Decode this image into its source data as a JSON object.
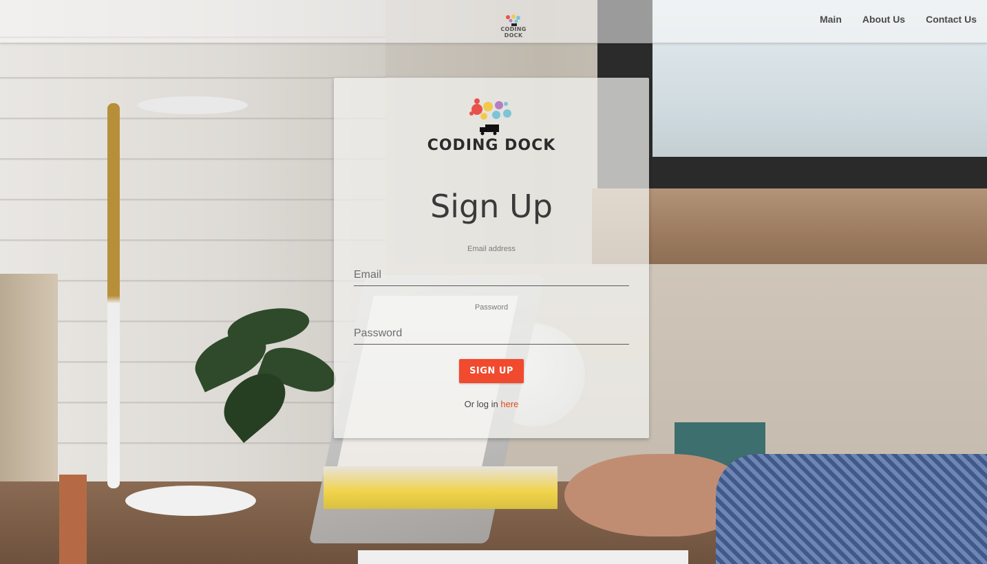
{
  "header": {
    "brand": "CODING DOCK",
    "nav": [
      {
        "label": "Main"
      },
      {
        "label": "About Us"
      },
      {
        "label": "Contact Us"
      }
    ]
  },
  "card": {
    "brand": "CODING DOCK",
    "title": "Sign Up",
    "email": {
      "label": "Email address",
      "placeholder": "Email",
      "value": ""
    },
    "password": {
      "label": "Password",
      "placeholder": "Password",
      "value": ""
    },
    "submit_label": "SIGN UP",
    "login_prefix": "Or log in",
    "login_link": "here"
  },
  "colors": {
    "accent": "#f14a2e",
    "link": "#e24a1f",
    "logo_red": "#e8524a",
    "logo_yellow": "#f2c94c",
    "logo_blue": "#7cc4d8",
    "logo_purple": "#b67ec2"
  },
  "icons": [
    "coding-dock-logo-icon",
    "truck-icon"
  ]
}
